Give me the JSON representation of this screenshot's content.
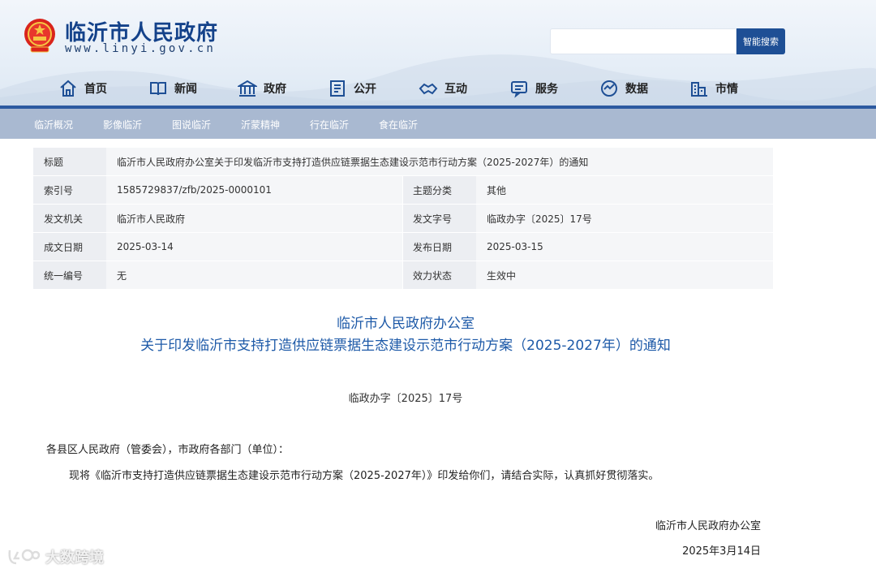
{
  "site": {
    "title": "临沂市人民政府",
    "url": "www.linyi.gov.cn",
    "search_placeholder": "",
    "search_button": "智能搜索"
  },
  "nav": [
    {
      "label": "首页",
      "icon": "home-icon"
    },
    {
      "label": "新闻",
      "icon": "news-icon"
    },
    {
      "label": "政府",
      "icon": "government-icon"
    },
    {
      "label": "公开",
      "icon": "disclosure-icon"
    },
    {
      "label": "互动",
      "icon": "interaction-icon"
    },
    {
      "label": "服务",
      "icon": "service-icon"
    },
    {
      "label": "数据",
      "icon": "data-icon"
    },
    {
      "label": "市情",
      "icon": "city-icon"
    }
  ],
  "subnav": [
    "临沂概况",
    "影像临沂",
    "图说临沂",
    "沂蒙精神",
    "行在临沂",
    "食在临沂"
  ],
  "info": {
    "title_label": "标题",
    "title_value": "临沂市人民政府办公室关于印发临沂市支持打造供应链票据生态建设示范市行动方案（2025-2027年）的通知",
    "rows": [
      {
        "l1": "索引号",
        "v1": "1585729837/zfb/2025-0000101",
        "l2": "主题分类",
        "v2": "其他"
      },
      {
        "l1": "发文机关",
        "v1": "临沂市人民政府",
        "l2": "发文字号",
        "v2": "临政办字〔2025〕17号"
      },
      {
        "l1": "成文日期",
        "v1": "2025-03-14",
        "l2": "发布日期",
        "v2": "2025-03-15"
      },
      {
        "l1": "统一编号",
        "v1": "无",
        "l2": "效力状态",
        "v2": "生效中"
      }
    ]
  },
  "doc": {
    "title_line1": "临沂市人民政府办公室",
    "title_line2": "关于印发临沂市支持打造供应链票据生态建设示范市行动方案（2025-2027年）的通知",
    "number": "临政办字〔2025〕17号",
    "salutation": "各县区人民政府（管委会），市政府各部门（单位）：",
    "body": "现将《临沂市支持打造供应链票据生态建设示范市行动方案（2025-2027年）》印发给你们，请结合实际，认真抓好贯彻落实。",
    "signature": "临沂市人民政府办公室",
    "date": "2025年3月14日"
  },
  "watermark": "大数跨境",
  "colors": {
    "brand": "#14428a",
    "accent": "#2c5aa0",
    "subnav": "#a9b9d1",
    "doc_title": "#1e5aa8"
  }
}
